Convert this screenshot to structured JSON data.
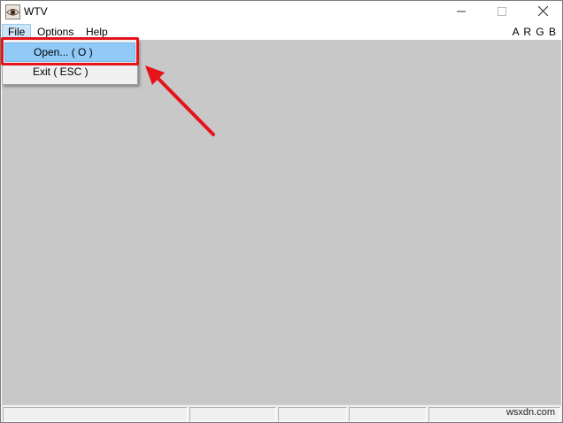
{
  "window": {
    "title": "WTV",
    "app_icon": "eye-icon",
    "controls": [
      "minimize-icon",
      "maximize-icon",
      "close-icon"
    ]
  },
  "menubar": {
    "items": [
      {
        "label": "File"
      },
      {
        "label": "Options"
      },
      {
        "label": "Help"
      }
    ],
    "channel_order": "A R G B"
  },
  "file_menu": {
    "items": [
      {
        "label": "Open... ( O )"
      },
      {
        "label": "Exit ( ESC )"
      }
    ]
  },
  "annotation": {
    "color": "#e5141b"
  },
  "statusbar": {
    "panes": [
      "",
      "",
      "",
      "",
      ""
    ],
    "watermark": "wsxdn.com"
  },
  "colors": {
    "client_bg": "#c8c8c8",
    "menu_highlight": "#91c9f7"
  }
}
